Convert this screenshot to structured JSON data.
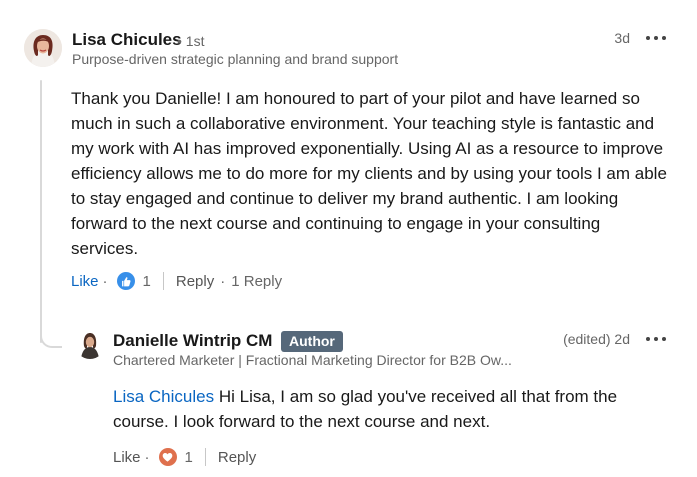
{
  "comment": {
    "author": "Lisa Chicules",
    "degree": "• 1st",
    "headline": "Purpose-driven strategic planning and brand support",
    "time": "3d",
    "text": "Thank you Danielle! I am honoured to part of your pilot and have learned so much in such a collaborative environment. Your teaching style is fantastic and my work with AI has improved exponentially. Using AI as a resource to improve efficiency allows me to do more for my clients and by using your tools I am able to stay engaged and continue to deliver my brand authentic. I am looking forward to the next course and continuing to engage in your consulting services.",
    "like_label": "Like",
    "like_dot": "·",
    "reaction_icon": "thumbs-up-icon",
    "reaction_count": "1",
    "reply_label": "Reply",
    "reply_dot": "·",
    "reply_count": "1 Reply"
  },
  "reply": {
    "author": "Danielle Wintrip CM",
    "badge": "Author",
    "headline": "Chartered Marketer | Fractional Marketing Director for B2B Ow...",
    "time": "(edited) 2d",
    "mention": "Lisa Chicules",
    "text": " Hi Lisa, I am so glad you've received all that from the course. I look forward to the next course and next.",
    "like_label": "Like",
    "like_dot": "·",
    "reaction_icon": "heart-icon",
    "reaction_count": "1",
    "reply_label": "Reply"
  },
  "colors": {
    "link": "#0a66c2",
    "badge": "#56687a",
    "like_reaction": "#378fe9",
    "love_reaction": "#df704d"
  }
}
